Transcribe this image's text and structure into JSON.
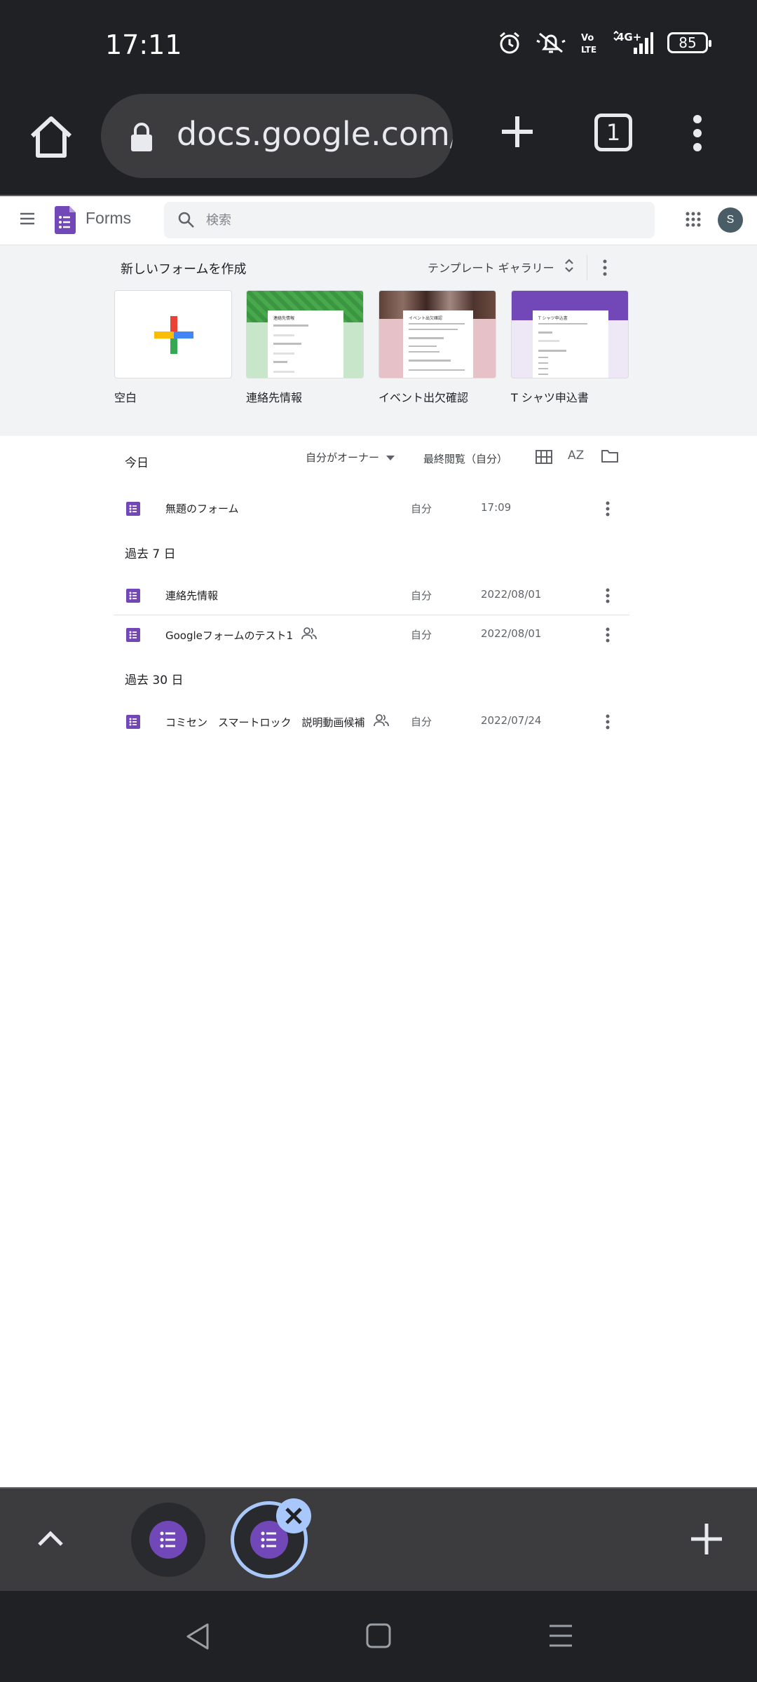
{
  "status_bar": {
    "time": "17:11",
    "battery": "85",
    "icons": [
      "alarm-icon",
      "bell-off-icon",
      "volte-icon",
      "signal-4g-icon"
    ],
    "volte_label": "Vo\nLTE",
    "network_label": "4G+"
  },
  "browser": {
    "url": "docs.google.com/",
    "tab_count": "1"
  },
  "forms_header": {
    "app_name": "Forms",
    "search_placeholder": "検索",
    "avatar_initial": "S",
    "brand_color": "#7248b9"
  },
  "templates": {
    "heading": "新しいフォームを作成",
    "gallery_label": "テンプレート ギャラリー",
    "items": [
      {
        "label": "空白",
        "thumb_color": "#ffffff"
      },
      {
        "label": "連絡先情報",
        "thumb_color": "#43a047"
      },
      {
        "label": "イベント出欠確認",
        "thumb_color": "#d8a3ab"
      },
      {
        "label": "T シャツ申込書",
        "thumb_color": "#7248b9"
      }
    ]
  },
  "list_toolbar": {
    "owner_filter": "自分がオーナー",
    "sort_label": "最終閲覧（自分）",
    "az_label": "AZ"
  },
  "sections": {
    "today": "今日",
    "past7": "過去 7 日",
    "past30": "過去 30 日"
  },
  "files": {
    "today": [
      {
        "name": "無題のフォーム",
        "owner": "自分",
        "date": "17:09",
        "shared": false
      }
    ],
    "past7": [
      {
        "name": "連絡先情報",
        "owner": "自分",
        "date": "2022/08/01",
        "shared": false
      },
      {
        "name": "Googleフォームのテスト1",
        "owner": "自分",
        "date": "2022/08/01",
        "shared": true
      }
    ],
    "past30": [
      {
        "name": "コミセン　スマートロック　説明動画候補",
        "owner": "自分",
        "date": "2022/07/24",
        "shared": true
      }
    ]
  }
}
